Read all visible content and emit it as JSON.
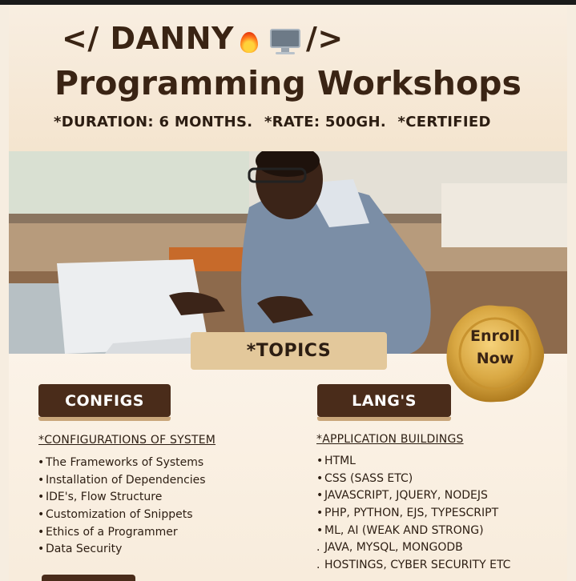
{
  "header": {
    "brand_prefix": "</ DANNY",
    "brand_suffix": "/>",
    "brand_icons": [
      "fire-icon",
      "desktop-computer-icon"
    ],
    "title": "Programming Workshops",
    "details": [
      "*DURATION: 6 MONTHS.",
      "*RATE: 500GH.",
      "*CERTIFIED"
    ]
  },
  "topics_label": "*TOPICS",
  "enroll": {
    "line1": "Enroll",
    "line2": "Now"
  },
  "configs": {
    "tag": "CONFIGS",
    "heading": "*CONFIGURATIONS OF SYSTEM",
    "items": [
      "The Frameworks of Systems",
      "Installation of Dependencies",
      "IDE's, Flow Structure",
      "Customization of Snippets",
      "Ethics of a Programmer",
      "Data Security"
    ]
  },
  "langs": {
    "tag": "LANG'S",
    "heading": "*APPLICATION BUILDINGS",
    "items": [
      {
        "bullet": "•",
        "text": "HTML"
      },
      {
        "bullet": "•",
        "text": "CSS (SASS ETC)"
      },
      {
        "bullet": "•",
        "text": "JAVASCRIPT, JQUERY, NODEJS"
      },
      {
        "bullet": "•",
        "text": "PHP, PYTHON, EJS, TYPESCRIPT"
      },
      {
        "bullet": "•",
        "text": "ML, AI (WEAK AND STRONG)"
      },
      {
        "bullet": ".",
        "text": "JAVA, MYSQL, MONGODB"
      },
      {
        "bullet": ".",
        "text": "HOSTINGS, CYBER SECURITY ETC"
      }
    ]
  },
  "colors": {
    "brown": "#4a2c1a",
    "gold": "#d9a843",
    "cream": "#f6ede0",
    "tan": "#e3c89b"
  }
}
